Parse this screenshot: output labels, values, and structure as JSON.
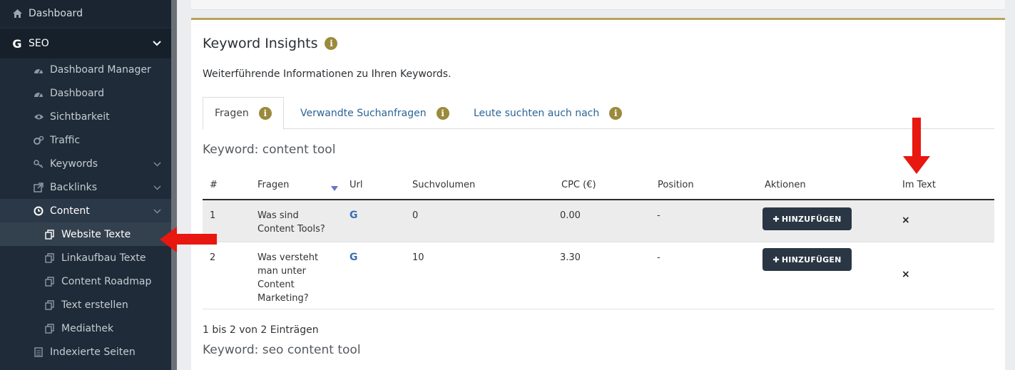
{
  "sidebar": {
    "top_item": {
      "label": "Dashboard",
      "icon": "home-icon"
    },
    "seo": {
      "label": "SEO",
      "icon": "google-icon"
    },
    "items": [
      {
        "label": "Dashboard Manager",
        "icon": "dashboard-icon"
      },
      {
        "label": "Dashboard",
        "icon": "dashboard-icon"
      },
      {
        "label": "Sichtbarkeit",
        "icon": "eye-icon"
      },
      {
        "label": "Traffic",
        "icon": "cogs-icon"
      },
      {
        "label": "Keywords",
        "icon": "key-icon",
        "expandable": true
      },
      {
        "label": "Backlinks",
        "icon": "external-link-icon",
        "expandable": true
      }
    ],
    "content": {
      "label": "Content",
      "icon": "clock-icon"
    },
    "content_items": [
      {
        "label": "Website Texte",
        "icon": "copy-icon",
        "active": true
      },
      {
        "label": "Linkaufbau Texte",
        "icon": "copy-icon"
      },
      {
        "label": "Content Roadmap",
        "icon": "copy-icon"
      },
      {
        "label": "Text erstellen",
        "icon": "copy-icon"
      },
      {
        "label": "Mediathek",
        "icon": "copy-icon"
      }
    ],
    "bottom_item": {
      "label": "Indexierte Seiten",
      "icon": "file-icon"
    }
  },
  "panel": {
    "title": "Keyword Insights",
    "description": "Weiterführende Informationen zu Ihren Keywords.",
    "tabs": [
      {
        "label": "Fragen",
        "active": true
      },
      {
        "label": "Verwandte Suchanfragen"
      },
      {
        "label": "Leute suchten auch nach"
      }
    ],
    "keyword_1": "Keyword: content tool",
    "keyword_2": "Keyword: seo content tool",
    "table": {
      "headers": [
        "#",
        "Fragen",
        "Url",
        "Suchvolumen",
        "CPC (€)",
        "Position",
        "Aktionen",
        "Im Text"
      ],
      "rows": [
        {
          "num": "1",
          "question": "Was sind Content Tools?",
          "url": "G",
          "volume": "0",
          "cpc": "0.00",
          "position": "-",
          "action": "HINZUFÜGEN",
          "in_text": "×"
        },
        {
          "num": "2",
          "question": "Was versteht man unter Content Marketing?",
          "url": "G",
          "volume": "10",
          "cpc": "3.30",
          "position": "-",
          "action": "HINZUFÜGEN",
          "in_text": "×"
        }
      ]
    },
    "entries_info": "1 bis 2 von 2 Einträgen"
  },
  "colors": {
    "sidebar_bg": "#1f2b38",
    "accent_gold": "#9b8a3c",
    "button_dark": "#2a3644",
    "link_blue": "#2a6496",
    "arrow_red": "#e8170f"
  }
}
